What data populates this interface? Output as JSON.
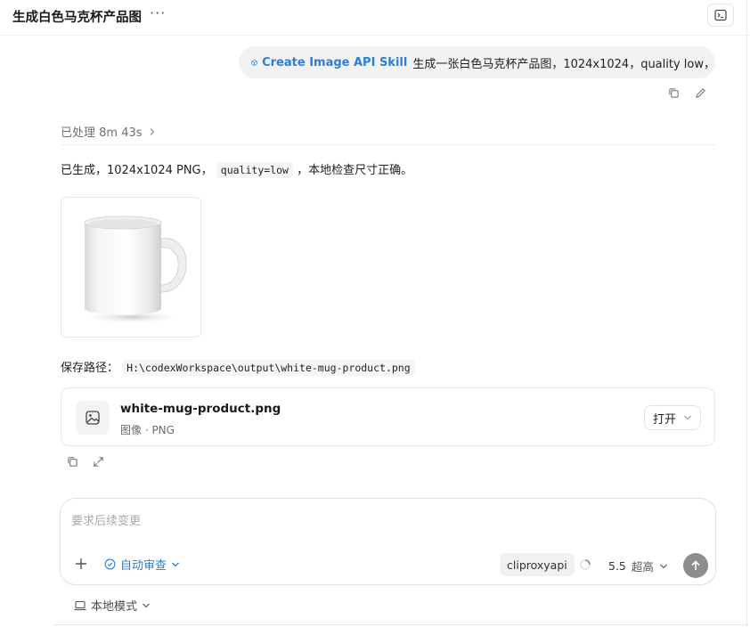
{
  "header": {
    "title": "生成白色马克杯产品图",
    "more_label": "···"
  },
  "user_message": {
    "skill_label": "Create Image API Skill",
    "text": "生成一张白色马克杯产品图，1024x1024，quality low，"
  },
  "assistant": {
    "processed_label": "已处理 8m 43s",
    "message_prefix": "已生成，1024x1024 PNG，",
    "message_code": "quality=low",
    "message_suffix": "，本地检查尺寸正确。",
    "path_label": "保存路径：",
    "path_value": "H:\\codexWorkspace\\output\\white-mug-product.png"
  },
  "file_card": {
    "name": "white-mug-product.png",
    "type": "图像 · PNG",
    "open_label": "打开"
  },
  "composer": {
    "placeholder": "要求后续变更",
    "auto_review_label": "自动审查",
    "provider": "cliproxyapi",
    "model_version": "5.5",
    "model_level": "超高"
  },
  "footer": {
    "mode_label": "本地模式"
  },
  "colors": {
    "accent": "#2b7fd6",
    "bubble_bg": "#f2f2f2",
    "send_button": "#8d8d8d"
  },
  "icons": {
    "skill": "cube-icon",
    "terminal": "terminal-icon",
    "copy": "copy-icon",
    "edit": "pencil-icon",
    "chevron": "chevron-right-icon",
    "image": "image-icon",
    "share": "share-icon",
    "plus": "plus-icon",
    "review": "review-icon",
    "spinner": "spinner-icon",
    "send": "arrow-up-icon",
    "laptop": "laptop-icon"
  }
}
